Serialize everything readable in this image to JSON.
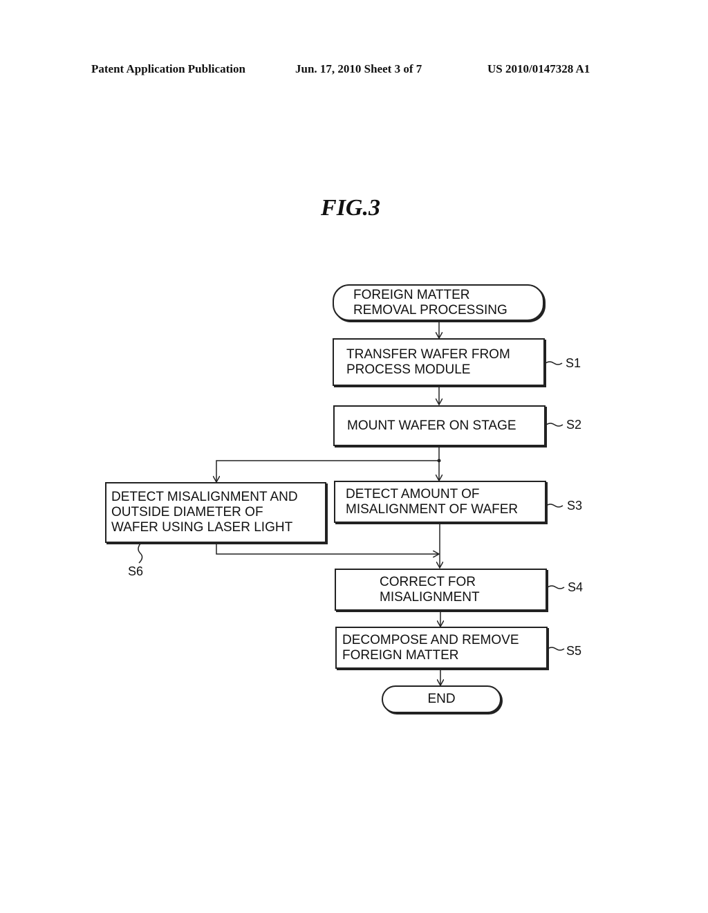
{
  "header": {
    "left": "Patent Application Publication",
    "middle": "Jun. 17, 2010  Sheet 3 of 7",
    "right": "US 2010/0147328 A1"
  },
  "figure": {
    "title": "FIG.3"
  },
  "flowchart": {
    "start": {
      "lines": [
        "FOREIGN MATTER",
        "REMOVAL PROCESSING"
      ]
    },
    "s1": {
      "label": "S1",
      "lines": [
        "TRANSFER WAFER FROM",
        "PROCESS MODULE"
      ]
    },
    "s2": {
      "label": "S2",
      "lines": [
        "MOUNT WAFER ON STAGE"
      ]
    },
    "s3": {
      "label": "S3",
      "lines": [
        "DETECT AMOUNT OF",
        "MISALIGNMENT OF WAFER"
      ]
    },
    "s6": {
      "label": "S6",
      "lines": [
        "DETECT MISALIGNMENT AND",
        "OUTSIDE DIAMETER OF",
        "WAFER USING LASER LIGHT"
      ]
    },
    "s4": {
      "label": "S4",
      "lines": [
        "CORRECT FOR",
        "MISALIGNMENT"
      ]
    },
    "s5": {
      "label": "S5",
      "lines": [
        "DECOMPOSE AND REMOVE",
        "FOREIGN MATTER"
      ]
    },
    "end": {
      "lines": [
        "END"
      ]
    }
  }
}
